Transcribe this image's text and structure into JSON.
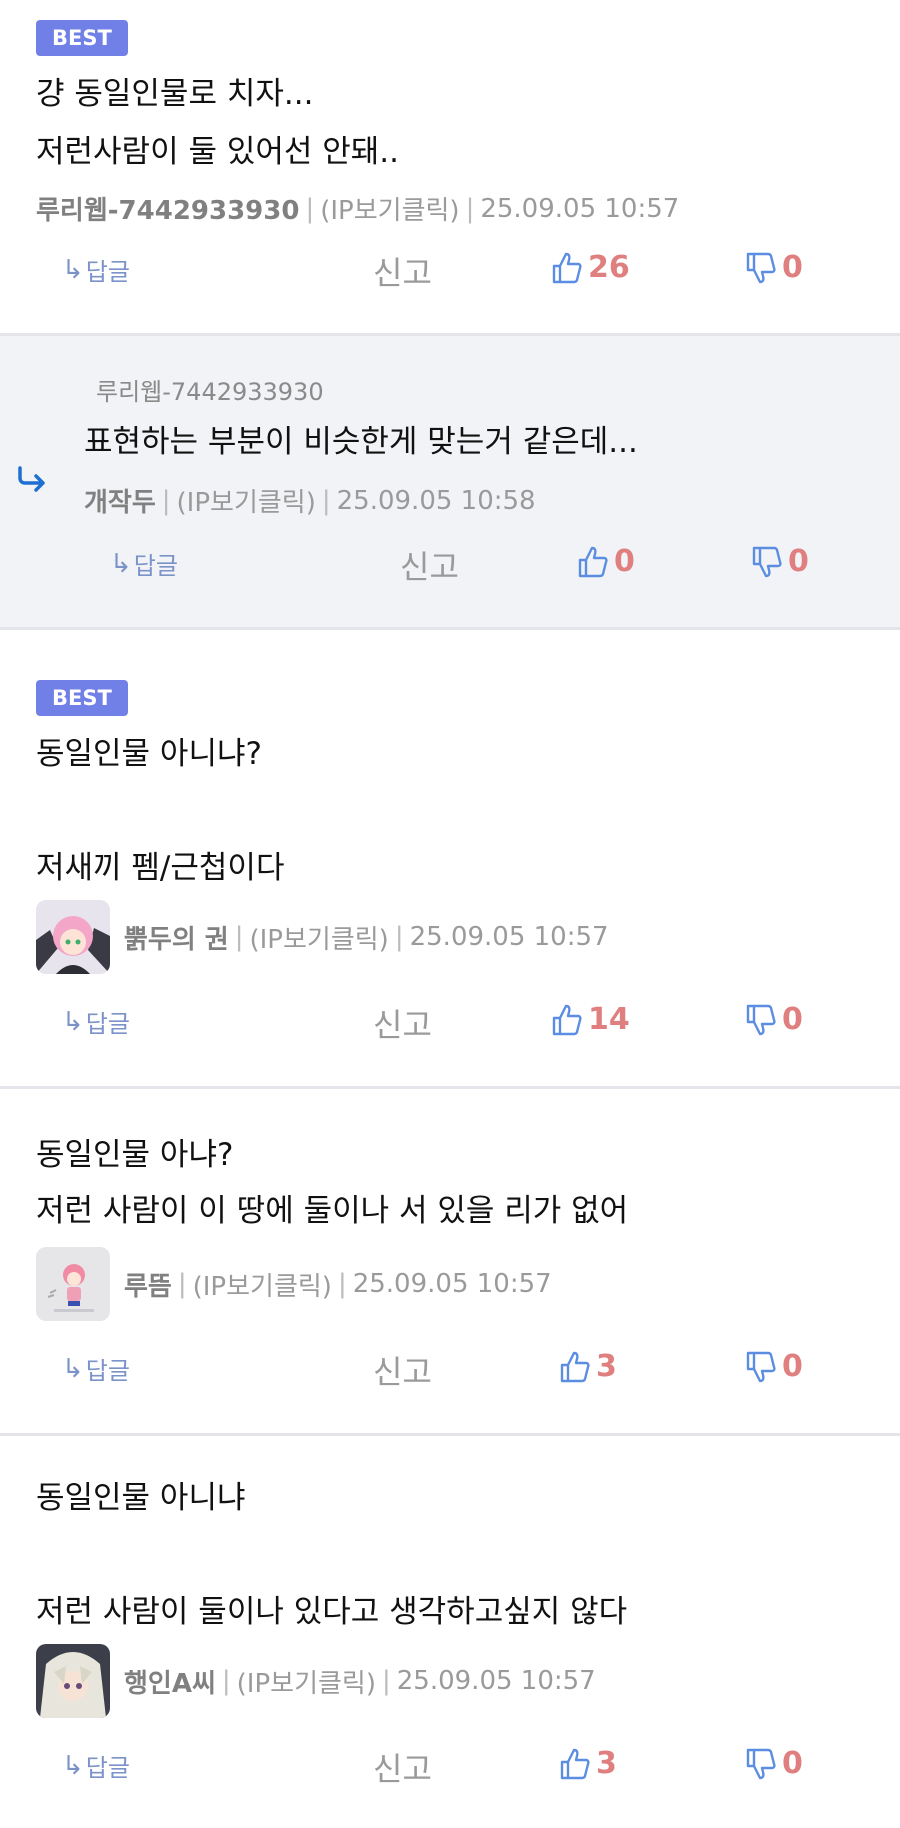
{
  "comments": [
    {
      "badge": "BEST",
      "lines": [
        "걍 동일인물로 치자...",
        "저런사람이 둘 있어선 안돼.."
      ],
      "nick": "루리웹-7442933930",
      "ip": "(IP보기클릭)",
      "time": "25.09.05 10:57",
      "reply_label": "답글",
      "report_label": "신고",
      "likes": "26",
      "dislikes": "0"
    },
    {
      "parent_nick": "루리웹-7442933930",
      "lines": [
        "표현하는 부분이 비슷한게 맞는거 같은데..."
      ],
      "nick": "개작두",
      "ip": "(IP보기클릭)",
      "time": "25.09.05 10:58",
      "reply_label": "답글",
      "report_label": "신고",
      "likes": "0",
      "dislikes": "0"
    },
    {
      "badge": "BEST",
      "lines": [
        "동일인물 아니냐?",
        "",
        "저새끼 펨/근첩이다"
      ],
      "nick": "뿕두의 권",
      "ip": "(IP보기클릭)",
      "time": "25.09.05 10:57",
      "reply_label": "답글",
      "report_label": "신고",
      "likes": "14",
      "dislikes": "0"
    },
    {
      "lines": [
        "동일인물 아냐?",
        "저런 사람이 이 땅에 둘이나 서 있을 리가 없어"
      ],
      "nick": "루뜸",
      "ip": "(IP보기클릭)",
      "time": "25.09.05 10:57",
      "reply_label": "답글",
      "report_label": "신고",
      "likes": "3",
      "dislikes": "0"
    },
    {
      "lines": [
        "동일인물 아니냐",
        "",
        "저런 사람이 둘이나 있다고 생각하고싶지 않다"
      ],
      "nick": "행인A씨",
      "ip": "(IP보기클릭)",
      "time": "25.09.05 10:57",
      "reply_label": "답글",
      "report_label": "신고",
      "likes": "3",
      "dislikes": "0"
    }
  ],
  "colors": {
    "best_badge": "#7180e6",
    "like_icon": "#5b8de0",
    "count": "#e07f7f",
    "reply_bg": "#f2f3f6"
  }
}
